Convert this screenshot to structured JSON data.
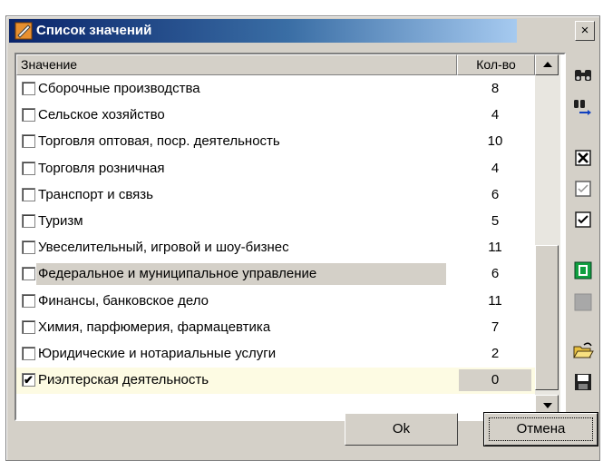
{
  "window": {
    "title": "Список значений",
    "close_label": "×"
  },
  "list": {
    "header": {
      "value_col": "Значение",
      "count_col": "Кол-во"
    },
    "rows": [
      {
        "label": "Сборочные производства",
        "count": "8",
        "checked": false
      },
      {
        "label": "Сельское хозяйство",
        "count": "4",
        "checked": false
      },
      {
        "label": "Торговля оптовая, поср. деятельность",
        "count": "10",
        "checked": false
      },
      {
        "label": "Торговля розничная",
        "count": "4",
        "checked": false
      },
      {
        "label": "Транспорт и связь",
        "count": "6",
        "checked": false
      },
      {
        "label": "Туризм",
        "count": "5",
        "checked": false
      },
      {
        "label": "Увеселительный, игровой и шоу-бизнес",
        "count": "11",
        "checked": false
      },
      {
        "label": "Федеральное и муниципальное управление",
        "count": "6",
        "checked": false
      },
      {
        "label": "Финансы, банковское дело",
        "count": "11",
        "checked": false
      },
      {
        "label": "Химия, парфюмерия, фармацевтика",
        "count": "7",
        "checked": false
      },
      {
        "label": "Юридические и нотариальные услуги",
        "count": "2",
        "checked": false
      },
      {
        "label": "Риэлтерская деятельность",
        "count": "0",
        "checked": true
      }
    ],
    "checkmark": "✔"
  },
  "toolbar": {
    "icons": [
      "find-icon",
      "find-next-icon",
      "check-all-icon",
      "uncheck-all-icon",
      "invert-check-icon",
      "refresh-icon",
      "clear-icon",
      "open-folder-icon",
      "save-icon"
    ]
  },
  "buttons": {
    "ok": "Ok",
    "cancel": "Отмена"
  }
}
